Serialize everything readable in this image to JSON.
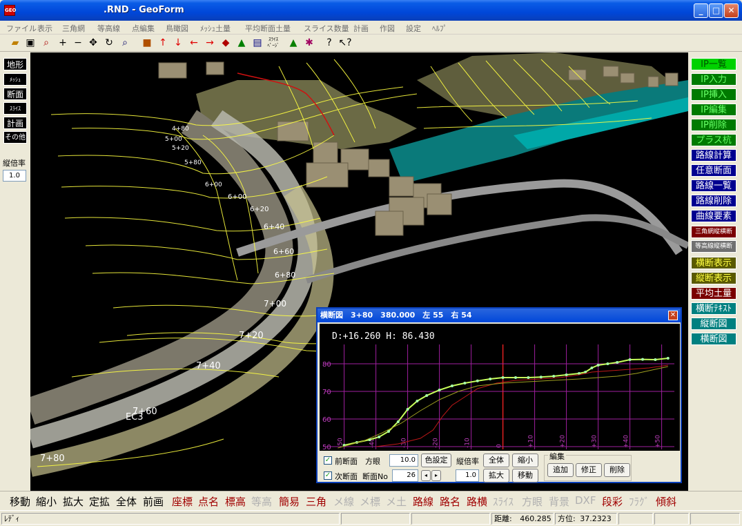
{
  "window": {
    "title": ".RND - GeoForm",
    "icon_text": "GEO"
  },
  "menu": [
    "ファイル",
    "表示",
    "三角網",
    "等高線",
    "点編集",
    "鳥瞰図",
    "ﾒｯｼｭ土量",
    "平均断面土量",
    "スライス数量",
    "計画",
    "作図",
    "設定",
    "ﾍﾙﾌﾟ"
  ],
  "left_buttons": [
    "地形",
    "ﾒｯｼｭ",
    "断面",
    "ｽﾗｲｽ",
    "計画",
    "その他"
  ],
  "vertical_ratio": {
    "label": "縦倍率",
    "value": "1.0"
  },
  "right_buttons": [
    "IP一覧",
    "IP入力",
    "IP挿入",
    "IP編集",
    "IP削除",
    "プラス杭",
    "路線計算",
    "任意断面",
    "路線一覧",
    "路線削除",
    "曲線要素",
    "三角網縦横断",
    "等高線縦横断",
    "横断表示",
    "縦断表示",
    "平均土量",
    "横断ﾃｷｽﾄ",
    "縦断図",
    "横断図"
  ],
  "bottom_buttons": [
    "移動",
    "縮小",
    "拡大",
    "定拡",
    "全体",
    "前画",
    "座標",
    "点名",
    "標高",
    "等高",
    "簡易",
    "三角",
    "メ線",
    "メ標",
    "メ土",
    "路線",
    "路名",
    "路横",
    "ｽﾗｲｽ",
    "方眼",
    "背景",
    "DXF",
    "段彩",
    "ﾌﾗｸﾞ",
    "傾斜"
  ],
  "status": {
    "ready": "ﾚﾃﾞｨ",
    "distance_label": "距離:",
    "distance": "460.285",
    "bearing_label": "方位:",
    "bearing": "37.2323"
  },
  "station_labels": [
    "4+80",
    "5+00",
    "5+20",
    "5+40",
    "5+60",
    "5+80",
    "6+00",
    "6+20",
    "6+40",
    "6+60",
    "6+80",
    "7+00",
    "7+20",
    "7+40",
    "7+60",
    "7+80",
    "EC3"
  ],
  "dialog": {
    "title": "横断図　3+80　380.000　左 55　右 54",
    "readout": "D:+16.260 H: 86.430",
    "prev_section_label": "前断面",
    "next_section_label": "次断面",
    "grid_label": "方眼",
    "grid_value": "10.0",
    "section_no_label": "断面No",
    "section_no": "26",
    "color_button": "色設定",
    "vratio_label": "縦倍率",
    "vratio_value": "1.0",
    "all_button": "全体",
    "shrink_button": "縮小",
    "enlarge_button": "拡大",
    "move_button": "移動",
    "edit_group": "編集",
    "add_button": "追加",
    "modify_button": "修正",
    "delete_button": "削除",
    "close_glyph": "✕"
  },
  "chart_data": {
    "type": "line",
    "x_ticks": [
      "-50",
      "-40",
      "-30",
      "-20",
      "-10",
      "0",
      "+10",
      "+20",
      "+30",
      "+40",
      "+50"
    ],
    "y_ticks": [
      "50",
      "60",
      "70",
      "80"
    ],
    "xlim": [
      -56,
      54
    ],
    "ylim": [
      49,
      87
    ],
    "series": [
      {
        "color": "#c8ff5a",
        "points": [
          [
            -50,
            50.5
          ],
          [
            -46,
            51.5
          ],
          [
            -42,
            52.5
          ],
          [
            -39,
            53.5
          ],
          [
            -36,
            55.5
          ],
          [
            -33,
            59
          ],
          [
            -30,
            63.5
          ],
          [
            -27,
            66.5
          ],
          [
            -24,
            68.5
          ],
          [
            -20,
            70.5
          ],
          [
            -16,
            72
          ],
          [
            -12,
            73
          ],
          [
            -8,
            73.8
          ],
          [
            -4,
            74.5
          ],
          [
            0,
            75
          ],
          [
            4,
            75
          ],
          [
            8,
            75
          ],
          [
            12,
            75.2
          ],
          [
            16,
            75.5
          ],
          [
            20,
            76
          ],
          [
            24,
            76.5
          ],
          [
            26,
            77
          ],
          [
            28,
            78.5
          ],
          [
            30,
            79.5
          ],
          [
            33,
            80
          ],
          [
            36,
            80.5
          ],
          [
            40,
            81.5
          ],
          [
            44,
            81.6
          ],
          [
            48,
            81.5
          ],
          [
            52,
            82
          ]
        ]
      },
      {
        "color": "#c01818",
        "points": [
          [
            -40,
            50
          ],
          [
            -33,
            51
          ],
          [
            -26,
            53
          ],
          [
            -22,
            56
          ],
          [
            -19,
            61
          ],
          [
            -16,
            65
          ],
          [
            -12,
            68
          ],
          [
            -8,
            71
          ],
          [
            -2,
            73
          ],
          [
            4,
            74
          ],
          [
            12,
            74.5
          ],
          [
            18,
            75
          ],
          [
            24,
            76
          ],
          [
            28,
            77
          ],
          [
            34,
            77.5
          ],
          [
            40,
            78
          ],
          [
            46,
            78.5
          ],
          [
            52,
            79.5
          ]
        ]
      },
      {
        "color": "#a0a020",
        "points": [
          [
            -52,
            49.5
          ],
          [
            -44,
            52
          ],
          [
            -38,
            55
          ],
          [
            -32,
            58.5
          ],
          [
            -26,
            63
          ],
          [
            -20,
            67
          ],
          [
            -14,
            70
          ],
          [
            -8,
            72
          ],
          [
            0,
            73
          ],
          [
            8,
            73.5
          ],
          [
            16,
            74
          ],
          [
            24,
            74.5
          ],
          [
            30,
            75
          ],
          [
            36,
            75.5
          ],
          [
            42,
            76.5
          ],
          [
            48,
            78
          ],
          [
            52,
            79
          ]
        ]
      }
    ]
  }
}
